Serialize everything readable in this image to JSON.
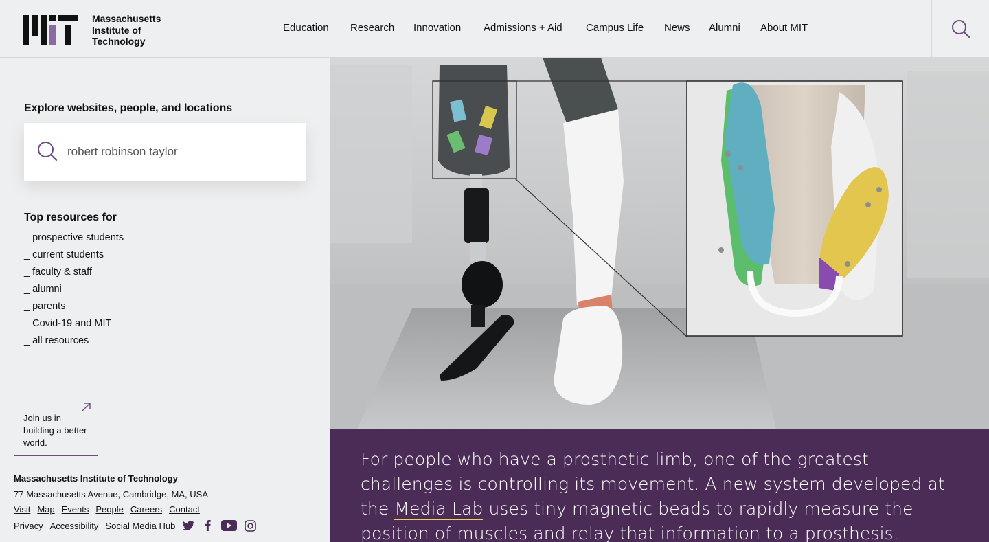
{
  "header": {
    "logo_lines": [
      "Massachusetts",
      "Institute of",
      "Technology"
    ],
    "nav": [
      {
        "label": "Education"
      },
      {
        "label": "Research"
      },
      {
        "label": "Innovation"
      },
      {
        "label": "Admissions + Aid"
      },
      {
        "label": "Campus Life"
      },
      {
        "label": "News"
      },
      {
        "label": "Alumni"
      },
      {
        "label": "About MIT"
      }
    ],
    "search_icon": "search-icon"
  },
  "sidebar": {
    "explore_label": "Explore websites, people, and locations",
    "search_value": "robert robinson taylor",
    "top_resources_label": "Top resources for",
    "resources": [
      "_ prospective students",
      "_ current students",
      "_ faculty & staff",
      "_ alumni",
      "_ parents",
      "_ Covid-19 and MIT",
      "_ all resources"
    ],
    "join": "Join us in building a better world.",
    "footer": {
      "name": "Massachusetts Institute of Technology",
      "address": "77 Massachusetts Avenue, Cambridge, MA, USA",
      "links_row1": [
        "Visit",
        "Map",
        "Events",
        "People",
        "Careers",
        "Contact"
      ],
      "links_row2": [
        "Privacy",
        "Accessibility",
        "Social Media Hub"
      ],
      "social": [
        "twitter-icon",
        "facebook-icon",
        "youtube-icon",
        "instagram-icon"
      ]
    }
  },
  "hero": {
    "caption_before": "For people who have a prosthetic limb, one of the greatest challenges is controlling its movement. A new system developed at the ",
    "caption_link": "Media Lab",
    "caption_after": " uses tiny magnetic beads to rapidly measure the position of muscles and relay that information to a prosthesis."
  },
  "colors": {
    "purple": "#4b2c57",
    "accent_purple": "#6e4a7e",
    "link_underline": "#f0d060",
    "background": "#eeeff0"
  }
}
